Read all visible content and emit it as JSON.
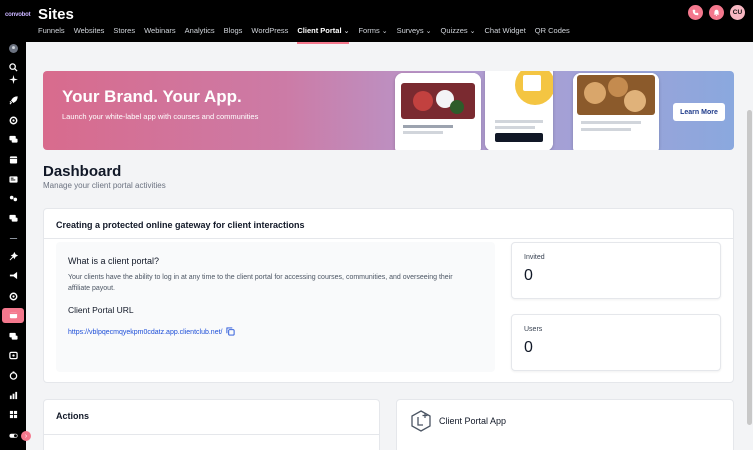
{
  "header": {
    "logo_text": "convobot",
    "title": "Sites",
    "nav": [
      {
        "label": "Funnels",
        "dropdown": false
      },
      {
        "label": "Websites",
        "dropdown": false
      },
      {
        "label": "Stores",
        "dropdown": false
      },
      {
        "label": "Webinars",
        "dropdown": false
      },
      {
        "label": "Analytics",
        "dropdown": false
      },
      {
        "label": "Blogs",
        "dropdown": false
      },
      {
        "label": "WordPress",
        "dropdown": false
      },
      {
        "label": "Client Portal",
        "dropdown": true,
        "active": true
      },
      {
        "label": "Forms",
        "dropdown": true
      },
      {
        "label": "Surveys",
        "dropdown": true
      },
      {
        "label": "Quizzes",
        "dropdown": true
      },
      {
        "label": "Chat Widget",
        "dropdown": false
      },
      {
        "label": "QR Codes",
        "dropdown": false
      }
    ],
    "avatar_initials": "CU"
  },
  "banner": {
    "title": "Your Brand. Your App.",
    "subtitle": "Launch your white-label app with courses and communities",
    "button_label": "Learn More"
  },
  "page": {
    "title": "Dashboard",
    "subtitle": "Manage your client portal activities"
  },
  "main_card": {
    "title": "Creating a protected online gateway for client interactions",
    "what_heading": "What is a client portal?",
    "what_body": "Your clients have the ability to log in at any time to the client portal for accessing courses, communities, and overseeing their affiliate payout.",
    "url_label": "Client Portal URL",
    "url": "https://vblpqecmqyekpm0cdatz.app.clientclub.net/"
  },
  "stats": {
    "invited_label": "Invited",
    "invited_value": "0",
    "users_label": "Users",
    "users_value": "0"
  },
  "actions": {
    "title": "Actions"
  },
  "portal_app": {
    "title": "Client Portal App"
  },
  "colors": {
    "accent": "#f4788d",
    "link": "#1d4ed8"
  }
}
